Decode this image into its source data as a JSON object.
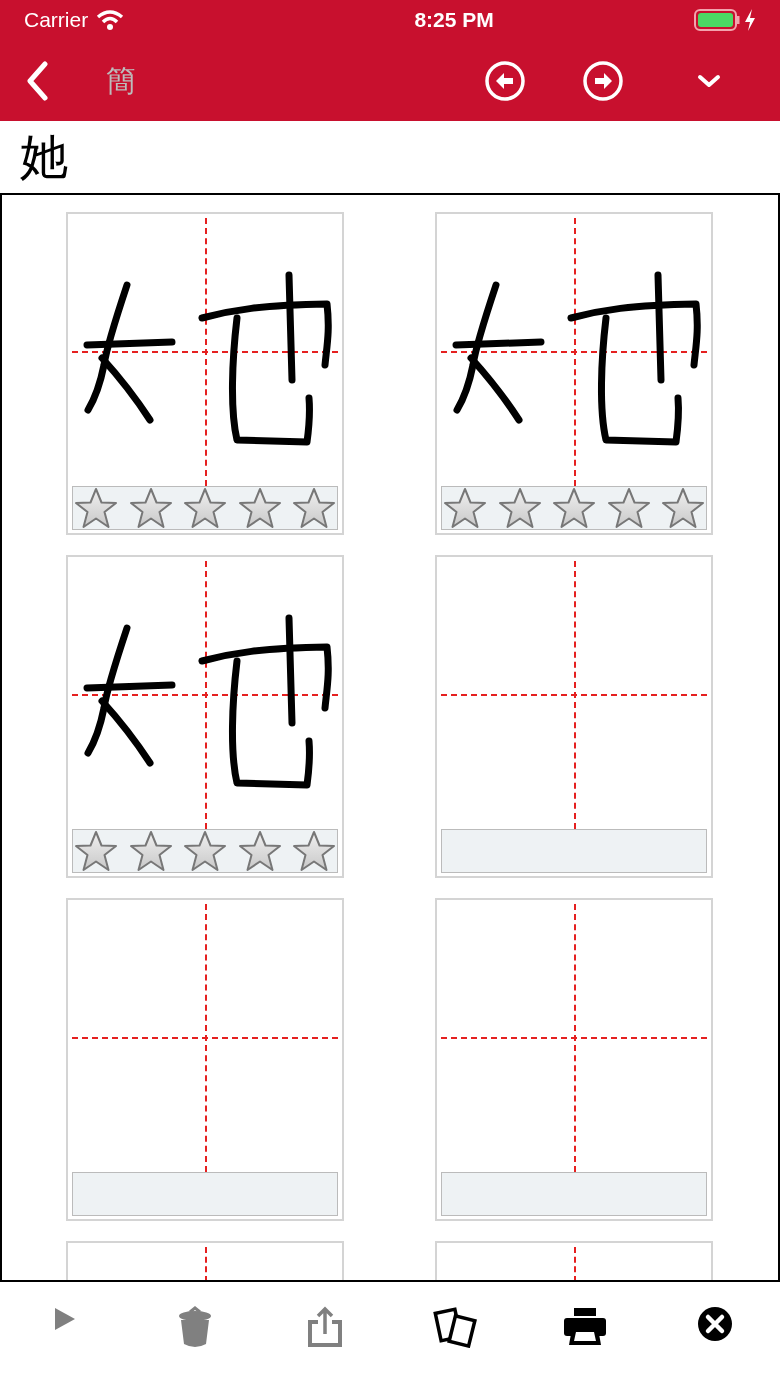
{
  "status_bar": {
    "carrier": "Carrier",
    "time": "8:25 PM"
  },
  "nav": {
    "script_toggle": "簡"
  },
  "character": "她",
  "cards": [
    {
      "kind": "written",
      "stars": 0
    },
    {
      "kind": "written",
      "stars": 0
    },
    {
      "kind": "written",
      "stars": 0
    },
    {
      "kind": "blank"
    },
    {
      "kind": "blank"
    },
    {
      "kind": "blank"
    },
    {
      "kind": "partial"
    },
    {
      "kind": "partial"
    }
  ],
  "toolbar": [
    {
      "kind": "play",
      "disabled": true
    },
    {
      "kind": "trash",
      "disabled": true
    },
    {
      "kind": "share",
      "disabled": true
    },
    {
      "kind": "cards",
      "disabled": false
    },
    {
      "kind": "print",
      "disabled": false
    },
    {
      "kind": "close",
      "disabled": false
    }
  ]
}
